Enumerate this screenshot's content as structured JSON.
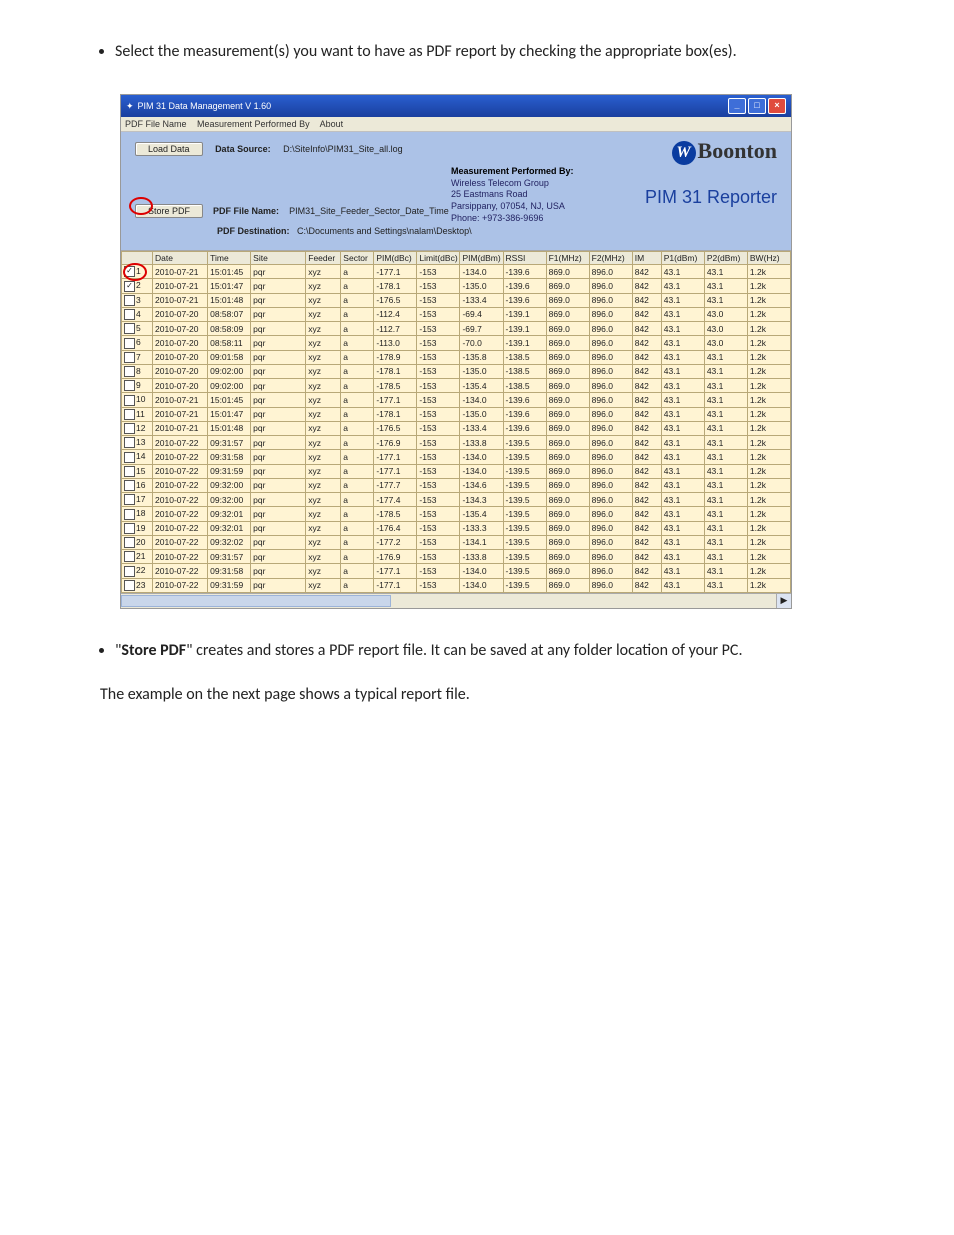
{
  "doc_bullet_1": "Select the measurement(s) you want to have as PDF report by checking the appropriate box(es).",
  "doc_bullet_2a": "\"",
  "doc_bullet_2_bold": "Store PDF",
  "doc_bullet_2b": "\" creates and stores a PDF report file. It can be saved at any folder location of your PC.",
  "doc_para_last": "The example on the next page shows a typical report file.",
  "app": {
    "title": "PIM 31 Data Management V 1.60",
    "menu": {
      "m1": "PDF File Name",
      "m2": "Measurement Performed By",
      "m3": "About"
    },
    "btn_load": "Load Data",
    "btn_store": "Store PDF",
    "lbl_datasource": "Data Source:",
    "val_datasource": "D:\\SiteInfo\\PIM31_Site_all.log",
    "lbl_pdfname": "PDF File Name:",
    "val_pdfname": "PIM31_Site_Feeder_Sector_Date_Time",
    "lbl_pdfdest": "PDF Destination:",
    "val_pdfdest": "C:\\Documents and Settings\\nalam\\Desktop\\",
    "brand_name": "Boonton",
    "reporter": "PIM 31 Reporter",
    "mp_title": "Measurement Performed By:",
    "mp_l1": "Wireless Telecom Group",
    "mp_l2": "25 Eastmans Road",
    "mp_l3": "Parsippany, 07054, NJ, USA",
    "mp_l4": "Phone: +973-386-9696"
  },
  "headers": [
    "",
    "Date",
    "Time",
    "Site",
    "Feeder",
    "Sector",
    "PIM(dBc)",
    "Limit(dBc)",
    "PIM(dBm)",
    "RSSI",
    "F1(MHz)",
    "F2(MHz)",
    "IM",
    "P1(dBm)",
    "P2(dBm)",
    "BW(Hz)"
  ],
  "rows": [
    {
      "n": 1,
      "chk": true,
      "date": "2010-07-21",
      "time": "15:01:45",
      "site": "pqr",
      "feeder": "xyz",
      "sector": "a",
      "pimdbc": "-177.1",
      "limit": "-153",
      "pimdbm": "-134.0",
      "rssi": "-139.6",
      "f1": "869.0",
      "f2": "896.0",
      "im": "842",
      "p1": "43.1",
      "p2": "43.1",
      "bw": "1.2k"
    },
    {
      "n": 2,
      "chk": true,
      "date": "2010-07-21",
      "time": "15:01:47",
      "site": "pqr",
      "feeder": "xyz",
      "sector": "a",
      "pimdbc": "-178.1",
      "limit": "-153",
      "pimdbm": "-135.0",
      "rssi": "-139.6",
      "f1": "869.0",
      "f2": "896.0",
      "im": "842",
      "p1": "43.1",
      "p2": "43.1",
      "bw": "1.2k"
    },
    {
      "n": 3,
      "chk": false,
      "date": "2010-07-21",
      "time": "15:01:48",
      "site": "pqr",
      "feeder": "xyz",
      "sector": "a",
      "pimdbc": "-176.5",
      "limit": "-153",
      "pimdbm": "-133.4",
      "rssi": "-139.6",
      "f1": "869.0",
      "f2": "896.0",
      "im": "842",
      "p1": "43.1",
      "p2": "43.1",
      "bw": "1.2k"
    },
    {
      "n": 4,
      "chk": false,
      "date": "2010-07-20",
      "time": "08:58:07",
      "site": "pqr",
      "feeder": "xyz",
      "sector": "a",
      "pimdbc": "-112.4",
      "limit": "-153",
      "pimdbm": "-69.4",
      "rssi": "-139.1",
      "f1": "869.0",
      "f2": "896.0",
      "im": "842",
      "p1": "43.1",
      "p2": "43.0",
      "bw": "1.2k"
    },
    {
      "n": 5,
      "chk": false,
      "date": "2010-07-20",
      "time": "08:58:09",
      "site": "pqr",
      "feeder": "xyz",
      "sector": "a",
      "pimdbc": "-112.7",
      "limit": "-153",
      "pimdbm": "-69.7",
      "rssi": "-139.1",
      "f1": "869.0",
      "f2": "896.0",
      "im": "842",
      "p1": "43.1",
      "p2": "43.0",
      "bw": "1.2k"
    },
    {
      "n": 6,
      "chk": false,
      "date": "2010-07-20",
      "time": "08:58:11",
      "site": "pqr",
      "feeder": "xyz",
      "sector": "a",
      "pimdbc": "-113.0",
      "limit": "-153",
      "pimdbm": "-70.0",
      "rssi": "-139.1",
      "f1": "869.0",
      "f2": "896.0",
      "im": "842",
      "p1": "43.1",
      "p2": "43.0",
      "bw": "1.2k"
    },
    {
      "n": 7,
      "chk": false,
      "date": "2010-07-20",
      "time": "09:01:58",
      "site": "pqr",
      "feeder": "xyz",
      "sector": "a",
      "pimdbc": "-178.9",
      "limit": "-153",
      "pimdbm": "-135.8",
      "rssi": "-138.5",
      "f1": "869.0",
      "f2": "896.0",
      "im": "842",
      "p1": "43.1",
      "p2": "43.1",
      "bw": "1.2k"
    },
    {
      "n": 8,
      "chk": false,
      "date": "2010-07-20",
      "time": "09:02:00",
      "site": "pqr",
      "feeder": "xyz",
      "sector": "a",
      "pimdbc": "-178.1",
      "limit": "-153",
      "pimdbm": "-135.0",
      "rssi": "-138.5",
      "f1": "869.0",
      "f2": "896.0",
      "im": "842",
      "p1": "43.1",
      "p2": "43.1",
      "bw": "1.2k"
    },
    {
      "n": 9,
      "chk": false,
      "date": "2010-07-20",
      "time": "09:02:00",
      "site": "pqr",
      "feeder": "xyz",
      "sector": "a",
      "pimdbc": "-178.5",
      "limit": "-153",
      "pimdbm": "-135.4",
      "rssi": "-138.5",
      "f1": "869.0",
      "f2": "896.0",
      "im": "842",
      "p1": "43.1",
      "p2": "43.1",
      "bw": "1.2k"
    },
    {
      "n": 10,
      "chk": false,
      "date": "2010-07-21",
      "time": "15:01:45",
      "site": "pqr",
      "feeder": "xyz",
      "sector": "a",
      "pimdbc": "-177.1",
      "limit": "-153",
      "pimdbm": "-134.0",
      "rssi": "-139.6",
      "f1": "869.0",
      "f2": "896.0",
      "im": "842",
      "p1": "43.1",
      "p2": "43.1",
      "bw": "1.2k"
    },
    {
      "n": 11,
      "chk": false,
      "date": "2010-07-21",
      "time": "15:01:47",
      "site": "pqr",
      "feeder": "xyz",
      "sector": "a",
      "pimdbc": "-178.1",
      "limit": "-153",
      "pimdbm": "-135.0",
      "rssi": "-139.6",
      "f1": "869.0",
      "f2": "896.0",
      "im": "842",
      "p1": "43.1",
      "p2": "43.1",
      "bw": "1.2k"
    },
    {
      "n": 12,
      "chk": false,
      "date": "2010-07-21",
      "time": "15:01:48",
      "site": "pqr",
      "feeder": "xyz",
      "sector": "a",
      "pimdbc": "-176.5",
      "limit": "-153",
      "pimdbm": "-133.4",
      "rssi": "-139.6",
      "f1": "869.0",
      "f2": "896.0",
      "im": "842",
      "p1": "43.1",
      "p2": "43.1",
      "bw": "1.2k"
    },
    {
      "n": 13,
      "chk": false,
      "date": "2010-07-22",
      "time": "09:31:57",
      "site": "pqr",
      "feeder": "xyz",
      "sector": "a",
      "pimdbc": "-176.9",
      "limit": "-153",
      "pimdbm": "-133.8",
      "rssi": "-139.5",
      "f1": "869.0",
      "f2": "896.0",
      "im": "842",
      "p1": "43.1",
      "p2": "43.1",
      "bw": "1.2k"
    },
    {
      "n": 14,
      "chk": false,
      "date": "2010-07-22",
      "time": "09:31:58",
      "site": "pqr",
      "feeder": "xyz",
      "sector": "a",
      "pimdbc": "-177.1",
      "limit": "-153",
      "pimdbm": "-134.0",
      "rssi": "-139.5",
      "f1": "869.0",
      "f2": "896.0",
      "im": "842",
      "p1": "43.1",
      "p2": "43.1",
      "bw": "1.2k"
    },
    {
      "n": 15,
      "chk": false,
      "date": "2010-07-22",
      "time": "09:31:59",
      "site": "pqr",
      "feeder": "xyz",
      "sector": "a",
      "pimdbc": "-177.1",
      "limit": "-153",
      "pimdbm": "-134.0",
      "rssi": "-139.5",
      "f1": "869.0",
      "f2": "896.0",
      "im": "842",
      "p1": "43.1",
      "p2": "43.1",
      "bw": "1.2k"
    },
    {
      "n": 16,
      "chk": false,
      "date": "2010-07-22",
      "time": "09:32:00",
      "site": "pqr",
      "feeder": "xyz",
      "sector": "a",
      "pimdbc": "-177.7",
      "limit": "-153",
      "pimdbm": "-134.6",
      "rssi": "-139.5",
      "f1": "869.0",
      "f2": "896.0",
      "im": "842",
      "p1": "43.1",
      "p2": "43.1",
      "bw": "1.2k"
    },
    {
      "n": 17,
      "chk": false,
      "date": "2010-07-22",
      "time": "09:32:00",
      "site": "pqr",
      "feeder": "xyz",
      "sector": "a",
      "pimdbc": "-177.4",
      "limit": "-153",
      "pimdbm": "-134.3",
      "rssi": "-139.5",
      "f1": "869.0",
      "f2": "896.0",
      "im": "842",
      "p1": "43.1",
      "p2": "43.1",
      "bw": "1.2k"
    },
    {
      "n": 18,
      "chk": false,
      "date": "2010-07-22",
      "time": "09:32:01",
      "site": "pqr",
      "feeder": "xyz",
      "sector": "a",
      "pimdbc": "-178.5",
      "limit": "-153",
      "pimdbm": "-135.4",
      "rssi": "-139.5",
      "f1": "869.0",
      "f2": "896.0",
      "im": "842",
      "p1": "43.1",
      "p2": "43.1",
      "bw": "1.2k"
    },
    {
      "n": 19,
      "chk": false,
      "date": "2010-07-22",
      "time": "09:32:01",
      "site": "pqr",
      "feeder": "xyz",
      "sector": "a",
      "pimdbc": "-176.4",
      "limit": "-153",
      "pimdbm": "-133.3",
      "rssi": "-139.5",
      "f1": "869.0",
      "f2": "896.0",
      "im": "842",
      "p1": "43.1",
      "p2": "43.1",
      "bw": "1.2k"
    },
    {
      "n": 20,
      "chk": false,
      "date": "2010-07-22",
      "time": "09:32:02",
      "site": "pqr",
      "feeder": "xyz",
      "sector": "a",
      "pimdbc": "-177.2",
      "limit": "-153",
      "pimdbm": "-134.1",
      "rssi": "-139.5",
      "f1": "869.0",
      "f2": "896.0",
      "im": "842",
      "p1": "43.1",
      "p2": "43.1",
      "bw": "1.2k"
    },
    {
      "n": 21,
      "chk": false,
      "date": "2010-07-22",
      "time": "09:31:57",
      "site": "pqr",
      "feeder": "xyz",
      "sector": "a",
      "pimdbc": "-176.9",
      "limit": "-153",
      "pimdbm": "-133.8",
      "rssi": "-139.5",
      "f1": "869.0",
      "f2": "896.0",
      "im": "842",
      "p1": "43.1",
      "p2": "43.1",
      "bw": "1.2k"
    },
    {
      "n": 22,
      "chk": false,
      "date": "2010-07-22",
      "time": "09:31:58",
      "site": "pqr",
      "feeder": "xyz",
      "sector": "a",
      "pimdbc": "-177.1",
      "limit": "-153",
      "pimdbm": "-134.0",
      "rssi": "-139.5",
      "f1": "869.0",
      "f2": "896.0",
      "im": "842",
      "p1": "43.1",
      "p2": "43.1",
      "bw": "1.2k"
    },
    {
      "n": 23,
      "chk": false,
      "date": "2010-07-22",
      "time": "09:31:59",
      "site": "pqr",
      "feeder": "xyz",
      "sector": "a",
      "pimdbc": "-177.1",
      "limit": "-153",
      "pimdbm": "-134.0",
      "rssi": "-139.5",
      "f1": "869.0",
      "f2": "896.0",
      "im": "842",
      "p1": "43.1",
      "p2": "43.1",
      "bw": "1.2k"
    }
  ]
}
